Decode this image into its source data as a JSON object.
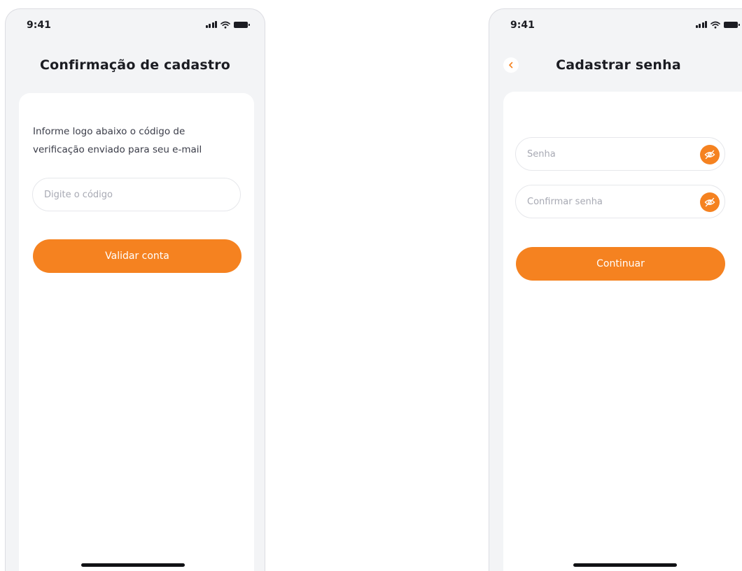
{
  "status_bar": {
    "time": "9:41"
  },
  "screen_confirm": {
    "title": "Confirmação de cadastro",
    "instruction": "Informe logo abaixo o código de verificação enviado para seu e-mail",
    "code_input": {
      "placeholder": "Digite o código",
      "value": ""
    },
    "submit_label": "Validar conta"
  },
  "screen_password": {
    "title": "Cadastrar senha",
    "password_input": {
      "placeholder": "Senha",
      "value": ""
    },
    "confirm_input": {
      "placeholder": "Confirmar senha",
      "value": ""
    },
    "submit_label": "Continuar"
  },
  "colors": {
    "accent": "#f58220",
    "screen_background": "#f3f4f6",
    "card_background": "#ffffff",
    "placeholder_text": "#a7a9b3"
  },
  "icons": {
    "back": "chevron-left-icon",
    "toggle_visibility": "eye-off-icon",
    "signal": "cellular-signal-icon",
    "wifi": "wifi-icon",
    "battery": "battery-icon"
  }
}
